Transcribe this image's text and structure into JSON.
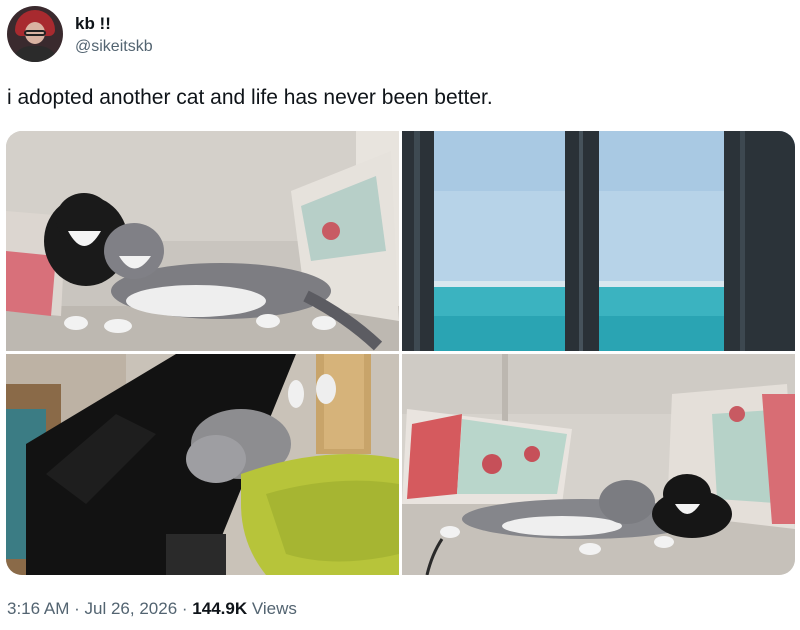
{
  "author": {
    "display_name": "kb !!",
    "handle": "@sikeitskb"
  },
  "tweet": {
    "text": "i adopted another cat and life has never been better."
  },
  "media": [
    {
      "name": "photo-cats-cuddling-on-couch"
    },
    {
      "name": "photo-ocean-view-window"
    },
    {
      "name": "photo-cats-playing-cat-tree"
    },
    {
      "name": "photo-cats-on-couch-pillows"
    }
  ],
  "meta": {
    "time": "3:16 AM",
    "separator": "·",
    "date": "Jul 26, 2026",
    "views_count": "144.9K",
    "views_label": "Views"
  }
}
